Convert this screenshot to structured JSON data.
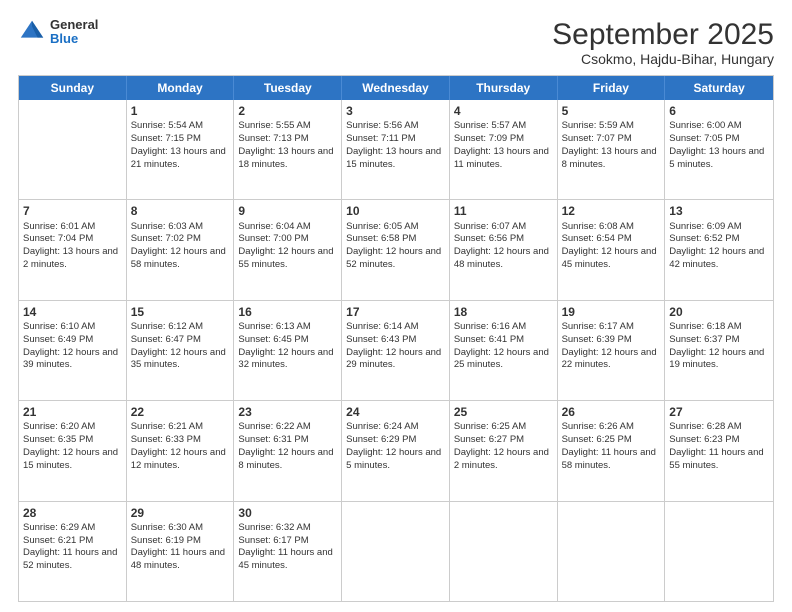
{
  "logo": {
    "general": "General",
    "blue": "Blue"
  },
  "title": "September 2025",
  "subtitle": "Csokmo, Hajdu-Bihar, Hungary",
  "header_days": [
    "Sunday",
    "Monday",
    "Tuesday",
    "Wednesday",
    "Thursday",
    "Friday",
    "Saturday"
  ],
  "weeks": [
    [
      {
        "day": "",
        "sunrise": "",
        "sunset": "",
        "daylight": ""
      },
      {
        "day": "1",
        "sunrise": "Sunrise: 5:54 AM",
        "sunset": "Sunset: 7:15 PM",
        "daylight": "Daylight: 13 hours and 21 minutes."
      },
      {
        "day": "2",
        "sunrise": "Sunrise: 5:55 AM",
        "sunset": "Sunset: 7:13 PM",
        "daylight": "Daylight: 13 hours and 18 minutes."
      },
      {
        "day": "3",
        "sunrise": "Sunrise: 5:56 AM",
        "sunset": "Sunset: 7:11 PM",
        "daylight": "Daylight: 13 hours and 15 minutes."
      },
      {
        "day": "4",
        "sunrise": "Sunrise: 5:57 AM",
        "sunset": "Sunset: 7:09 PM",
        "daylight": "Daylight: 13 hours and 11 minutes."
      },
      {
        "day": "5",
        "sunrise": "Sunrise: 5:59 AM",
        "sunset": "Sunset: 7:07 PM",
        "daylight": "Daylight: 13 hours and 8 minutes."
      },
      {
        "day": "6",
        "sunrise": "Sunrise: 6:00 AM",
        "sunset": "Sunset: 7:05 PM",
        "daylight": "Daylight: 13 hours and 5 minutes."
      }
    ],
    [
      {
        "day": "7",
        "sunrise": "Sunrise: 6:01 AM",
        "sunset": "Sunset: 7:04 PM",
        "daylight": "Daylight: 13 hours and 2 minutes."
      },
      {
        "day": "8",
        "sunrise": "Sunrise: 6:03 AM",
        "sunset": "Sunset: 7:02 PM",
        "daylight": "Daylight: 12 hours and 58 minutes."
      },
      {
        "day": "9",
        "sunrise": "Sunrise: 6:04 AM",
        "sunset": "Sunset: 7:00 PM",
        "daylight": "Daylight: 12 hours and 55 minutes."
      },
      {
        "day": "10",
        "sunrise": "Sunrise: 6:05 AM",
        "sunset": "Sunset: 6:58 PM",
        "daylight": "Daylight: 12 hours and 52 minutes."
      },
      {
        "day": "11",
        "sunrise": "Sunrise: 6:07 AM",
        "sunset": "Sunset: 6:56 PM",
        "daylight": "Daylight: 12 hours and 48 minutes."
      },
      {
        "day": "12",
        "sunrise": "Sunrise: 6:08 AM",
        "sunset": "Sunset: 6:54 PM",
        "daylight": "Daylight: 12 hours and 45 minutes."
      },
      {
        "day": "13",
        "sunrise": "Sunrise: 6:09 AM",
        "sunset": "Sunset: 6:52 PM",
        "daylight": "Daylight: 12 hours and 42 minutes."
      }
    ],
    [
      {
        "day": "14",
        "sunrise": "Sunrise: 6:10 AM",
        "sunset": "Sunset: 6:49 PM",
        "daylight": "Daylight: 12 hours and 39 minutes."
      },
      {
        "day": "15",
        "sunrise": "Sunrise: 6:12 AM",
        "sunset": "Sunset: 6:47 PM",
        "daylight": "Daylight: 12 hours and 35 minutes."
      },
      {
        "day": "16",
        "sunrise": "Sunrise: 6:13 AM",
        "sunset": "Sunset: 6:45 PM",
        "daylight": "Daylight: 12 hours and 32 minutes."
      },
      {
        "day": "17",
        "sunrise": "Sunrise: 6:14 AM",
        "sunset": "Sunset: 6:43 PM",
        "daylight": "Daylight: 12 hours and 29 minutes."
      },
      {
        "day": "18",
        "sunrise": "Sunrise: 6:16 AM",
        "sunset": "Sunset: 6:41 PM",
        "daylight": "Daylight: 12 hours and 25 minutes."
      },
      {
        "day": "19",
        "sunrise": "Sunrise: 6:17 AM",
        "sunset": "Sunset: 6:39 PM",
        "daylight": "Daylight: 12 hours and 22 minutes."
      },
      {
        "day": "20",
        "sunrise": "Sunrise: 6:18 AM",
        "sunset": "Sunset: 6:37 PM",
        "daylight": "Daylight: 12 hours and 19 minutes."
      }
    ],
    [
      {
        "day": "21",
        "sunrise": "Sunrise: 6:20 AM",
        "sunset": "Sunset: 6:35 PM",
        "daylight": "Daylight: 12 hours and 15 minutes."
      },
      {
        "day": "22",
        "sunrise": "Sunrise: 6:21 AM",
        "sunset": "Sunset: 6:33 PM",
        "daylight": "Daylight: 12 hours and 12 minutes."
      },
      {
        "day": "23",
        "sunrise": "Sunrise: 6:22 AM",
        "sunset": "Sunset: 6:31 PM",
        "daylight": "Daylight: 12 hours and 8 minutes."
      },
      {
        "day": "24",
        "sunrise": "Sunrise: 6:24 AM",
        "sunset": "Sunset: 6:29 PM",
        "daylight": "Daylight: 12 hours and 5 minutes."
      },
      {
        "day": "25",
        "sunrise": "Sunrise: 6:25 AM",
        "sunset": "Sunset: 6:27 PM",
        "daylight": "Daylight: 12 hours and 2 minutes."
      },
      {
        "day": "26",
        "sunrise": "Sunrise: 6:26 AM",
        "sunset": "Sunset: 6:25 PM",
        "daylight": "Daylight: 11 hours and 58 minutes."
      },
      {
        "day": "27",
        "sunrise": "Sunrise: 6:28 AM",
        "sunset": "Sunset: 6:23 PM",
        "daylight": "Daylight: 11 hours and 55 minutes."
      }
    ],
    [
      {
        "day": "28",
        "sunrise": "Sunrise: 6:29 AM",
        "sunset": "Sunset: 6:21 PM",
        "daylight": "Daylight: 11 hours and 52 minutes."
      },
      {
        "day": "29",
        "sunrise": "Sunrise: 6:30 AM",
        "sunset": "Sunset: 6:19 PM",
        "daylight": "Daylight: 11 hours and 48 minutes."
      },
      {
        "day": "30",
        "sunrise": "Sunrise: 6:32 AM",
        "sunset": "Sunset: 6:17 PM",
        "daylight": "Daylight: 11 hours and 45 minutes."
      },
      {
        "day": "",
        "sunrise": "",
        "sunset": "",
        "daylight": ""
      },
      {
        "day": "",
        "sunrise": "",
        "sunset": "",
        "daylight": ""
      },
      {
        "day": "",
        "sunrise": "",
        "sunset": "",
        "daylight": ""
      },
      {
        "day": "",
        "sunrise": "",
        "sunset": "",
        "daylight": ""
      }
    ]
  ]
}
